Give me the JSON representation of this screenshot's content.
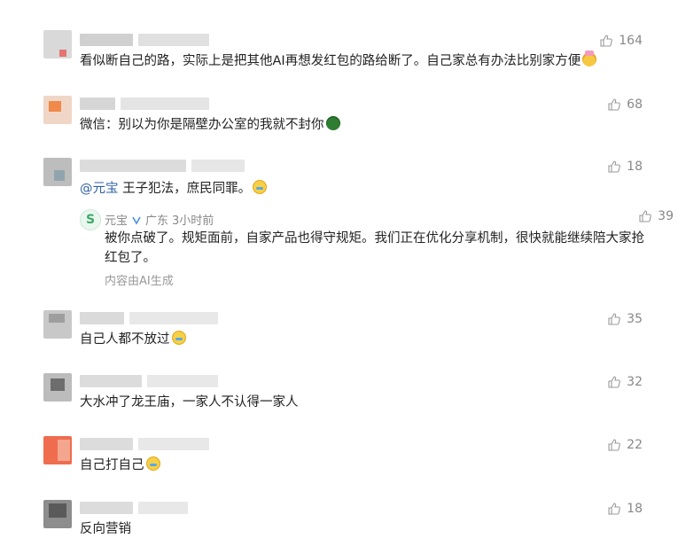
{
  "comments": [
    {
      "text": "看似断自己的路，实际上是把其他AI再想发红包的路给断了。自己家总有办法比别家方便",
      "emoji": "cake-face",
      "likes": "164"
    },
    {
      "text": "微信：别以为你是隔壁办公室的我就不封你",
      "emoji": "turtle",
      "likes": "68"
    },
    {
      "mention": "@元宝",
      "text": " 王子犯法，庶民同罪。",
      "emoji": "crying-face",
      "likes": "18",
      "reply": {
        "name": "元宝",
        "location": "广东",
        "time": "3小时前",
        "likes": "39",
        "text": "被你点破了。规矩面前，自家产品也得守规矩。我们正在优化分享机制，很快就能继续陪大家抢红包了。",
        "note": "内容由AI生成"
      }
    },
    {
      "text": "自己人都不放过",
      "emoji": "crying-face",
      "likes": "35"
    },
    {
      "text": "大水冲了龙王庙，一家人不认得一家人",
      "likes": "32"
    },
    {
      "text": "自己打自己",
      "emoji": "crying-face",
      "likes": "22"
    },
    {
      "text": "反向营销",
      "likes": "18"
    }
  ]
}
